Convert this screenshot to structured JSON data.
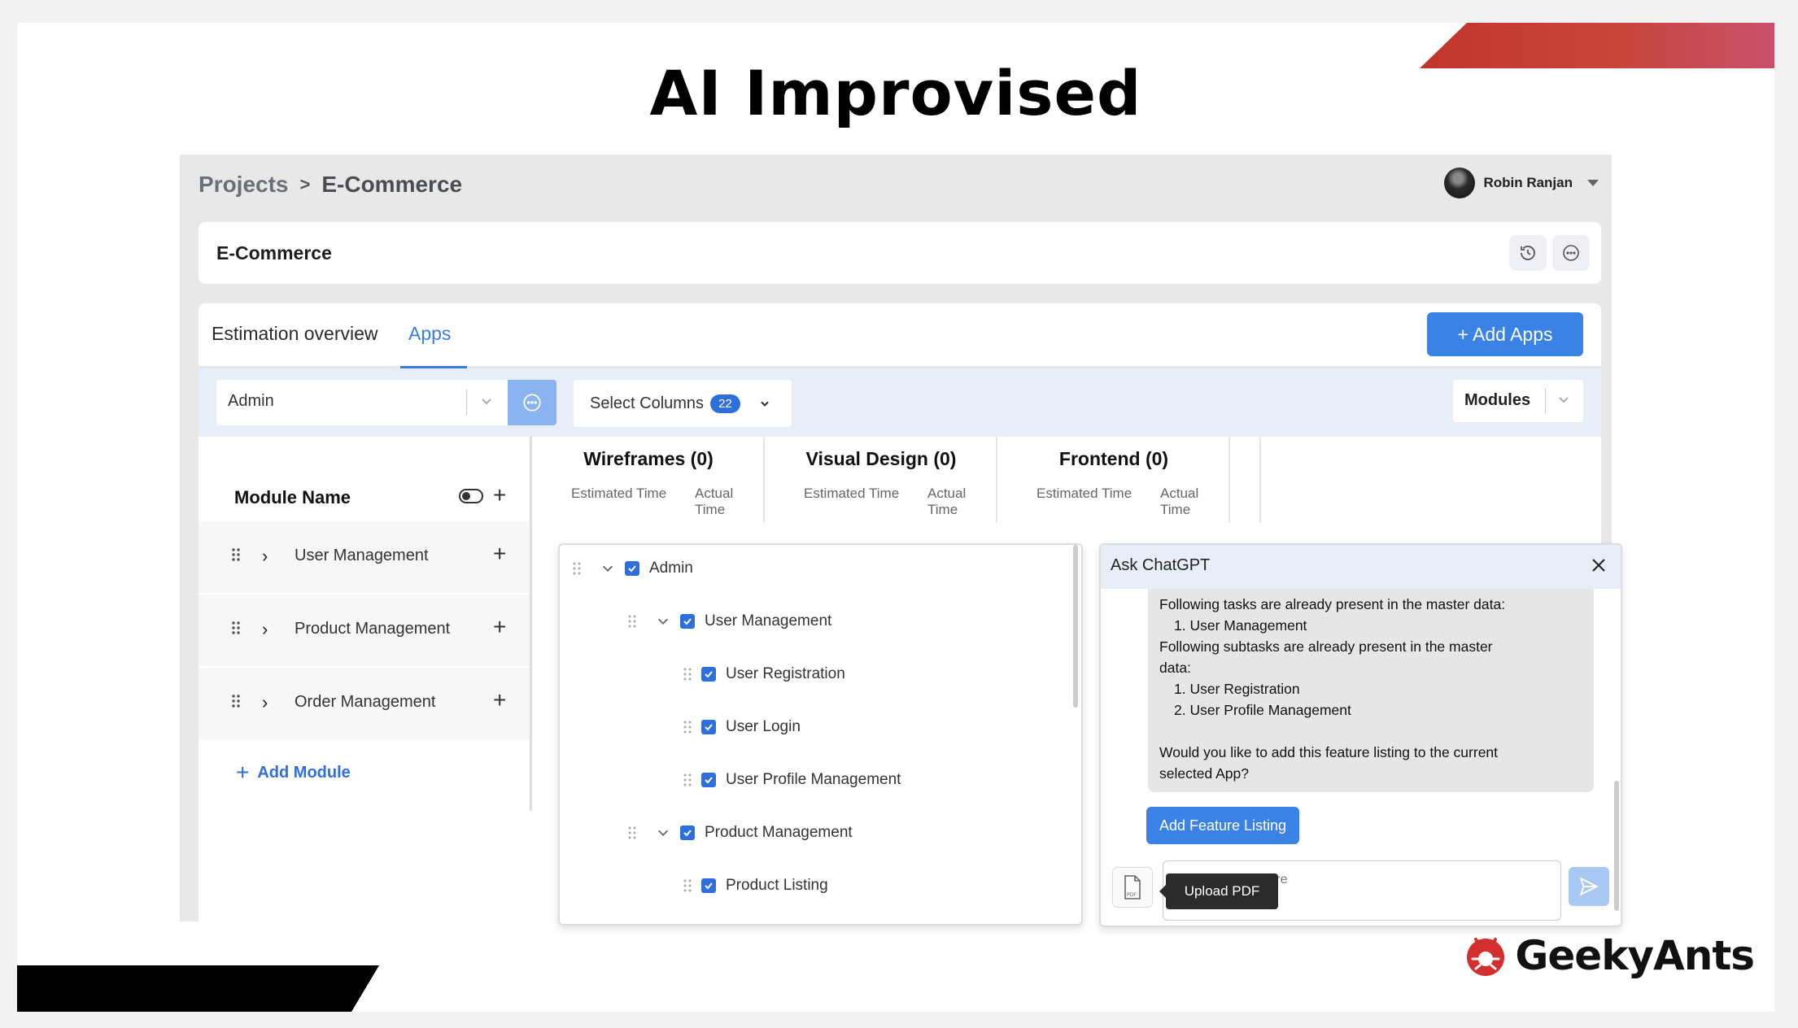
{
  "slide": {
    "title": "AI Improvised",
    "brand": "GeekyAnts"
  },
  "header": {
    "breadcrumb": [
      "Projects",
      "E-Commerce"
    ],
    "separator": ">",
    "user_name": "Robin Ranjan"
  },
  "project": {
    "name": "E-Commerce"
  },
  "tabs": [
    {
      "label": "Estimation overview",
      "active": false
    },
    {
      "label": "Apps",
      "active": true
    }
  ],
  "add_apps_label": "+ Add Apps",
  "filters": {
    "app_select": "Admin",
    "select_columns_label": "Select Columns",
    "select_columns_count": "22",
    "modules_label": "Modules"
  },
  "modules": {
    "header": "Module Name",
    "items": [
      "User Management",
      "Product Management",
      "Order Management"
    ],
    "add_label": "Add Module"
  },
  "columns": [
    {
      "title": "Wireframes (0)",
      "sub1": "Estimated Time",
      "sub2": "Actual Time"
    },
    {
      "title": "Visual Design (0)",
      "sub1": "Estimated Time",
      "sub2": "Actual Time"
    },
    {
      "title": "Frontend (0)",
      "sub1": "Estimated Time",
      "sub2": "Actual Time"
    }
  ],
  "tree": [
    {
      "label": "Admin",
      "level": 0,
      "expandable": true
    },
    {
      "label": "User Management",
      "level": 1,
      "expandable": true
    },
    {
      "label": "User Registration",
      "level": 2,
      "expandable": false
    },
    {
      "label": "User Login",
      "level": 2,
      "expandable": false
    },
    {
      "label": "User Profile Management",
      "level": 2,
      "expandable": false
    },
    {
      "label": "Product Management",
      "level": 1,
      "expandable": true
    },
    {
      "label": "Product Listing",
      "level": 2,
      "expandable": false
    }
  ],
  "chat": {
    "title": "Ask ChatGPT",
    "lines": [
      {
        "text": "Following tasks are already present in the master data:",
        "indent": false
      },
      {
        "text": "1. User Management",
        "indent": true
      },
      {
        "text": "Following subtasks are already present in the master",
        "indent": false
      },
      {
        "text": "data:",
        "indent": false
      },
      {
        "text": "1. User Registration",
        "indent": true
      },
      {
        "text": "2. User Profile Management",
        "indent": true
      },
      {
        "text": "",
        "indent": false
      },
      {
        "text": "Would you like to add this feature listing to the current",
        "indent": false
      },
      {
        "text": "selected App?",
        "indent": false
      }
    ],
    "add_feature_label": "Add Feature Listing",
    "input_placeholder": "Type message here",
    "tooltip": "Upload PDF",
    "pdf_icon_text": "PDF"
  },
  "colors": {
    "accent": "#3b82e6",
    "brand_red": "#c1352c"
  }
}
